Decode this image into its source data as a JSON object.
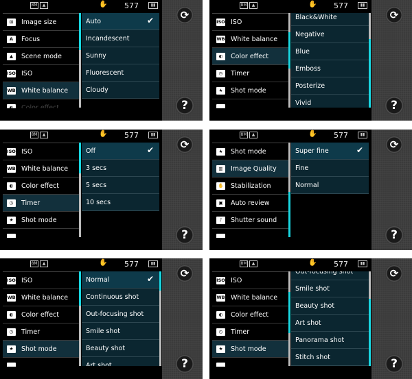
{
  "status": {
    "shots_remaining": "577"
  },
  "colors": {
    "accent": "#19d6e0",
    "selected_row": "#12303c",
    "option_row": "#0b2630"
  },
  "side_buttons": {
    "rotate_icon": "camera-switch-icon",
    "help_label": "?"
  },
  "panels": [
    {
      "menu": [
        {
          "label": "Image size",
          "icon": "⊡"
        },
        {
          "label": "Focus",
          "icon": "A"
        },
        {
          "label": "Scene mode",
          "icon": "▲"
        },
        {
          "label": "ISO",
          "icon": "ISO"
        },
        {
          "label": "White balance",
          "icon": "WB"
        },
        {
          "label": "Color effect",
          "icon": "◐"
        }
      ],
      "menu_selected": 4,
      "options": [
        "Auto",
        "Incandescent",
        "Sunny",
        "Fluorescent",
        "Cloudy"
      ],
      "checked": 0
    },
    {
      "menu": [
        {
          "label": "ISO",
          "icon": "ISO"
        },
        {
          "label": "White balance",
          "icon": "WB"
        },
        {
          "label": "Color effect",
          "icon": "◐"
        },
        {
          "label": "Timer",
          "icon": "◷"
        },
        {
          "label": "Shot mode",
          "icon": "★"
        },
        {
          "label": "",
          "icon": ""
        }
      ],
      "menu_selected": 2,
      "options": [
        "Black&White",
        "Negative",
        "Blue",
        "Emboss",
        "Posterize",
        "Vivid"
      ],
      "checked": -1
    },
    {
      "menu": [
        {
          "label": "ISO",
          "icon": "ISO"
        },
        {
          "label": "White balance",
          "icon": "WB"
        },
        {
          "label": "Color effect",
          "icon": "◐"
        },
        {
          "label": "Timer",
          "icon": "◷"
        },
        {
          "label": "Shot mode",
          "icon": "★"
        },
        {
          "label": "",
          "icon": ""
        }
      ],
      "menu_selected": 3,
      "options": [
        "Off",
        "3 secs",
        "5 secs",
        "10 secs"
      ],
      "checked": 0
    },
    {
      "menu": [
        {
          "label": "Shot mode",
          "icon": "★"
        },
        {
          "label": "Image Quality",
          "icon": "▥"
        },
        {
          "label": "Stabilization",
          "icon": "✋"
        },
        {
          "label": "Auto review",
          "icon": "▣"
        },
        {
          "label": "Shutter sound",
          "icon": "♪"
        },
        {
          "label": "",
          "icon": ""
        }
      ],
      "menu_selected": 1,
      "options": [
        "Super fine",
        "Fine",
        "Normal"
      ],
      "checked": 0
    },
    {
      "menu": [
        {
          "label": "ISO",
          "icon": "ISO"
        },
        {
          "label": "White balance",
          "icon": "WB"
        },
        {
          "label": "Color effect",
          "icon": "◐"
        },
        {
          "label": "Timer",
          "icon": "◷"
        },
        {
          "label": "Shot mode",
          "icon": "★"
        },
        {
          "label": "",
          "icon": ""
        }
      ],
      "menu_selected": 4,
      "options": [
        "Normal",
        "Continuous shot",
        "Out-focusing shot",
        "Smile shot",
        "Beauty shot",
        "Art shot"
      ],
      "checked": 0
    },
    {
      "menu": [
        {
          "label": "ISO",
          "icon": "ISO"
        },
        {
          "label": "White balance",
          "icon": "WB"
        },
        {
          "label": "Color effect",
          "icon": "◐"
        },
        {
          "label": "Timer",
          "icon": "◷"
        },
        {
          "label": "Shot mode",
          "icon": "★"
        },
        {
          "label": "",
          "icon": ""
        }
      ],
      "menu_selected": 4,
      "options": [
        "Out-focusing shot",
        "Smile shot",
        "Beauty shot",
        "Art shot",
        "Panorama shot",
        "Stitch shot"
      ],
      "checked": -1
    }
  ]
}
